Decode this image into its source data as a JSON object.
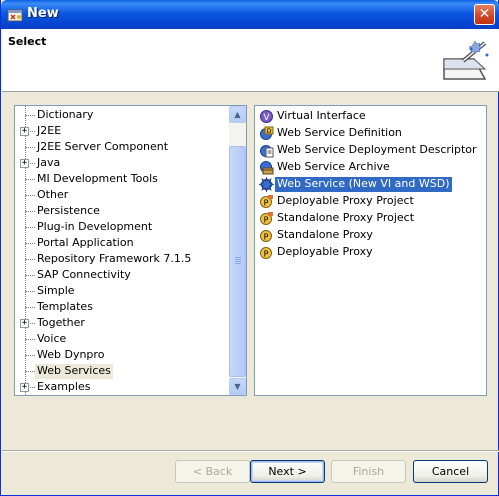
{
  "window": {
    "title": "New",
    "close_glyph": "✕"
  },
  "header": {
    "title": "Select"
  },
  "left_tree": {
    "items": [
      {
        "label": "Dictionary",
        "expandable": false
      },
      {
        "label": "J2EE",
        "expandable": true
      },
      {
        "label": "J2EE Server Component",
        "expandable": false
      },
      {
        "label": "Java",
        "expandable": true
      },
      {
        "label": "MI Development Tools",
        "expandable": false
      },
      {
        "label": "Other",
        "expandable": false
      },
      {
        "label": "Persistence",
        "expandable": false
      },
      {
        "label": "Plug-in Development",
        "expandable": false
      },
      {
        "label": "Portal Application",
        "expandable": false
      },
      {
        "label": "Repository Framework 7.1.5",
        "expandable": false
      },
      {
        "label": "SAP Connectivity",
        "expandable": false
      },
      {
        "label": "Simple",
        "expandable": false
      },
      {
        "label": "Templates",
        "expandable": false
      },
      {
        "label": "Together",
        "expandable": true
      },
      {
        "label": "Voice",
        "expandable": false
      },
      {
        "label": "Web Dynpro",
        "expandable": false
      },
      {
        "label": "Web Services",
        "expandable": false,
        "selected": true
      },
      {
        "label": "Examples",
        "expandable": true
      }
    ],
    "expander_glyph": "+",
    "scroll_up_glyph": "▲",
    "scroll_down_glyph": "▼"
  },
  "right_list": {
    "items": [
      {
        "label": "Virtual Interface",
        "icon": "virtual-interface-icon"
      },
      {
        "label": "Web Service Definition",
        "icon": "web-service-definition-icon"
      },
      {
        "label": "Web Service Deployment Descriptor",
        "icon": "deployment-descriptor-icon"
      },
      {
        "label": "Web Service Archive",
        "icon": "archive-icon"
      },
      {
        "label": "Web Service (New VI and WSD)",
        "icon": "web-service-wizard-icon",
        "selected": true
      },
      {
        "label": "Deployable Proxy Project",
        "icon": "proxy-project-icon"
      },
      {
        "label": "Standalone Proxy Project",
        "icon": "proxy-project-icon"
      },
      {
        "label": "Standalone Proxy",
        "icon": "proxy-icon"
      },
      {
        "label": "Deployable Proxy",
        "icon": "proxy-icon"
      }
    ]
  },
  "buttons": {
    "back": "< Back",
    "next": "Next >",
    "finish": "Finish",
    "cancel": "Cancel"
  },
  "colors": {
    "titlebar": "#0a5fe0",
    "selection": "#316ac5",
    "dialog_bg": "#ece9d8"
  }
}
